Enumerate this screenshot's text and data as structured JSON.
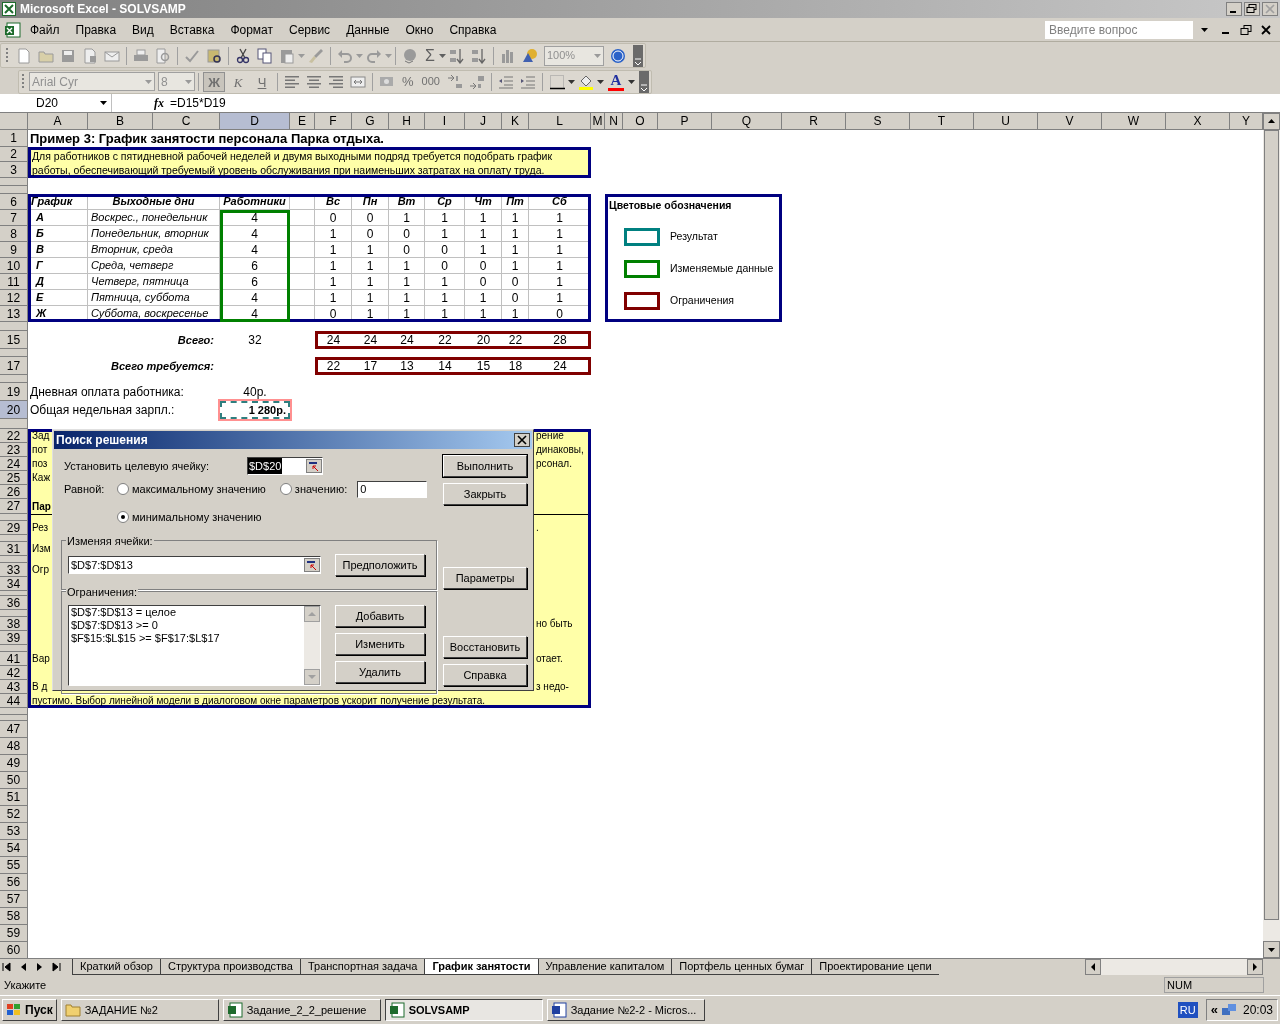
{
  "window": {
    "title": "Microsoft Excel - SOLVSAMP"
  },
  "menu": [
    "Файл",
    "Правка",
    "Вид",
    "Вставка",
    "Формат",
    "Сервис",
    "Данные",
    "Окно",
    "Справка"
  ],
  "help_search": {
    "placeholder": "Введите вопрос"
  },
  "toolbar": {
    "sum": "Σ",
    "zoom": "100%",
    "font": "Arial Cyr",
    "size": "8",
    "styles": [
      {
        "label": "Ж",
        "selected": true
      },
      {
        "label": "К",
        "selected": false
      },
      {
        "label": "Ч",
        "selected": false
      }
    ],
    "percent": "%",
    "thousands": "000",
    "font_color": "A"
  },
  "formula_bar": {
    "name_box": "D20",
    "fx": "fx",
    "formula": "=D15*D19"
  },
  "columns": [
    {
      "label": "A",
      "selected": false
    },
    {
      "label": "B",
      "selected": false
    },
    {
      "label": "C",
      "selected": false
    },
    {
      "label": "D",
      "selected": true
    },
    {
      "label": "E",
      "selected": false
    },
    {
      "label": "F",
      "selected": false
    },
    {
      "label": "G",
      "selected": false
    },
    {
      "label": "H",
      "selected": false
    },
    {
      "label": "I",
      "selected": false
    },
    {
      "label": "J",
      "selected": false
    },
    {
      "label": "K",
      "selected": false
    },
    {
      "label": "L",
      "selected": false
    },
    {
      "label": "M",
      "selected": false
    },
    {
      "label": "N",
      "selected": false
    },
    {
      "label": "O",
      "selected": false
    },
    {
      "label": "P",
      "selected": false
    },
    {
      "label": "Q",
      "selected": false
    },
    {
      "label": "R",
      "selected": false
    },
    {
      "label": "S",
      "selected": false
    },
    {
      "label": "T",
      "selected": false
    },
    {
      "label": "U",
      "selected": false
    },
    {
      "label": "V",
      "selected": false
    },
    {
      "label": "W",
      "selected": false
    },
    {
      "label": "X",
      "selected": false
    },
    {
      "label": "Y",
      "selected": false
    }
  ],
  "rows": [
    {
      "label": "1",
      "selected": false
    },
    {
      "label": "2",
      "selected": false
    },
    {
      "label": "3",
      "selected": false
    },
    {
      "label": "6",
      "selected": false
    },
    {
      "label": "7",
      "selected": false
    },
    {
      "label": "8",
      "selected": false
    },
    {
      "label": "9",
      "selected": false
    },
    {
      "label": "10",
      "selected": false
    },
    {
      "label": "11",
      "selected": false
    },
    {
      "label": "12",
      "selected": false
    },
    {
      "label": "13",
      "selected": false
    },
    {
      "label": "15",
      "selected": false
    },
    {
      "label": "17",
      "selected": false
    },
    {
      "label": "19",
      "selected": false
    },
    {
      "label": "20",
      "selected": true
    },
    {
      "label": "22",
      "selected": false
    },
    {
      "label": "23",
      "selected": false
    },
    {
      "label": "24",
      "selected": false
    },
    {
      "label": "25",
      "selected": false
    },
    {
      "label": "26",
      "selected": false
    },
    {
      "label": "27",
      "selected": false
    },
    {
      "label": "29",
      "selected": false
    },
    {
      "label": "31",
      "selected": false
    },
    {
      "label": "33",
      "selected": false
    },
    {
      "label": "34",
      "selected": false
    },
    {
      "label": "36",
      "selected": false
    },
    {
      "label": "38",
      "selected": false
    },
    {
      "label": "39",
      "selected": false
    },
    {
      "label": "41",
      "selected": false
    },
    {
      "label": "42",
      "selected": false
    },
    {
      "label": "43",
      "selected": false
    },
    {
      "label": "44",
      "selected": false
    },
    {
      "label": "47",
      "selected": false
    },
    {
      "label": "48",
      "selected": false
    },
    {
      "label": "49",
      "selected": false
    },
    {
      "label": "50",
      "selected": false
    },
    {
      "label": "51",
      "selected": false
    },
    {
      "label": "52",
      "selected": false
    },
    {
      "label": "53",
      "selected": false
    },
    {
      "label": "54",
      "selected": false
    },
    {
      "label": "55",
      "selected": false
    },
    {
      "label": "56",
      "selected": false
    },
    {
      "label": "57",
      "selected": false
    },
    {
      "label": "58",
      "selected": false
    },
    {
      "label": "59",
      "selected": false
    },
    {
      "label": "60",
      "selected": false
    }
  ],
  "sheet": {
    "title": "Пример 3:  График занятости персонала Парка отдыха.",
    "description": [
      "Для работников с пятидневной рабочей неделей и двумя выходными подряд требуется подобрать график",
      "работы, обеспечивающий требуемый уровень обслуживания при наименьших затратах на оплату труда."
    ],
    "schedule": {
      "headers": [
        "График",
        "Выходные дни",
        "Работники"
      ],
      "days": [
        "Вс",
        "Пн",
        "Вт",
        "Ср",
        "Чт",
        "Пт",
        "Сб"
      ],
      "rows": [
        {
          "schedule": "А",
          "days_off": "Воскрес., понедельник",
          "workers": "4",
          "values": [
            "0",
            "0",
            "1",
            "1",
            "1",
            "1",
            "1"
          ]
        },
        {
          "schedule": "Б",
          "days_off": "Понедельник, вторник",
          "workers": "4",
          "values": [
            "1",
            "0",
            "0",
            "1",
            "1",
            "1",
            "1"
          ]
        },
        {
          "schedule": "В",
          "days_off": "Вторник, среда",
          "workers": "4",
          "values": [
            "1",
            "1",
            "0",
            "0",
            "1",
            "1",
            "1"
          ]
        },
        {
          "schedule": "Г",
          "days_off": "Среда, четверг",
          "workers": "6",
          "values": [
            "1",
            "1",
            "1",
            "0",
            "0",
            "1",
            "1"
          ]
        },
        {
          "schedule": "Д",
          "days_off": "Четверг, пятница",
          "workers": "6",
          "values": [
            "1",
            "1",
            "1",
            "1",
            "0",
            "0",
            "1"
          ]
        },
        {
          "schedule": "Е",
          "days_off": "Пятница, суббота",
          "workers": "4",
          "values": [
            "1",
            "1",
            "1",
            "1",
            "1",
            "0",
            "1"
          ]
        },
        {
          "schedule": "Ж",
          "days_off": "Суббота, воскресенье",
          "workers": "4",
          "values": [
            "0",
            "1",
            "1",
            "1",
            "1",
            "1",
            "0"
          ]
        }
      ]
    },
    "totals": {
      "label": "Всего:",
      "workers": "32",
      "values": [
        "24",
        "24",
        "24",
        "22",
        "20",
        "22",
        "28"
      ]
    },
    "required": {
      "label": "Всего требуется:",
      "values": [
        "22",
        "17",
        "13",
        "14",
        "15",
        "18",
        "24"
      ]
    },
    "daily_pay": {
      "label": "Дневная оплата работника:",
      "value": "40р."
    },
    "weekly_pay": {
      "label": "Общая недельная зарпл.:",
      "value": "1 280р."
    },
    "notes": [
      {
        "left": "Зад",
        "right": "рение",
        "bold": false
      },
      {
        "left": "пот",
        "right": "динаковы,",
        "bold": false
      },
      {
        "left": "поз",
        "right": "рсонал.",
        "bold": false
      },
      {
        "left": "Каж",
        "bold": false
      },
      {
        "left": "Пар",
        "bold": true
      },
      {
        "left": "Рез",
        "right": ".",
        "bold": false
      },
      {
        "left": "Изм",
        "bold": false
      },
      {
        "left": "Огр",
        "bold": false
      },
      {
        "right": "но быть",
        "bold": false
      },
      {
        "left": "Вар",
        "right": "отает.",
        "bold": false
      },
      {
        "left": "В д",
        "right": "з недо-",
        "bold": false
      },
      {
        "left": "пустимо. Выбор линейной модели в диалоговом окне параметров ускорит получение результата.",
        "bold": false
      }
    ],
    "legend": {
      "title": "Цветовые обозначения",
      "items": [
        {
          "label": "Результат",
          "color": "#008080"
        },
        {
          "label": "Изменяемые данные",
          "color": "#008000"
        },
        {
          "label": "Ограничения",
          "color": "#800000"
        }
      ]
    }
  },
  "dialog": {
    "title": "Поиск решения",
    "target_label": "Установить целевую ячейку:",
    "target": "$D$20",
    "target_selected": true,
    "equal_label": "Равной:",
    "options": [
      {
        "label": "максимальному значению",
        "selected": false
      },
      {
        "label": "значению:",
        "selected": false
      },
      {
        "label": "минимальному значению",
        "selected": true
      }
    ],
    "value": "0",
    "changing_label": "Изменяя ячейки:",
    "changing": "$D$7:$D$13",
    "guess": "Предположить",
    "constraints_label": "Ограничения:",
    "constraints": [
      "$D$7:$D$13 = целое",
      "$D$7:$D$13 >= 0",
      "$F$15:$L$15 >= $F$17:$L$17"
    ],
    "constraint_buttons": [
      "Добавить",
      "Изменить",
      "Удалить"
    ],
    "buttons": [
      {
        "label": "Выполнить",
        "default": true
      },
      {
        "label": "Закрыть",
        "default": false
      },
      {
        "label": "Параметры",
        "default": false
      },
      {
        "label": "Восстановить",
        "default": false
      },
      {
        "label": "Справка",
        "default": false
      }
    ]
  },
  "sheet_tabs": [
    {
      "label": "Краткий обзор",
      "selected": false
    },
    {
      "label": "Структура производства",
      "selected": false
    },
    {
      "label": "Транспортная задача",
      "selected": false
    },
    {
      "label": "График занятости",
      "selected": true
    },
    {
      "label": "Управление капиталом",
      "selected": false
    },
    {
      "label": "Портфель ценных бумаг",
      "selected": false
    },
    {
      "label": "Проектирование цепи",
      "selected": false
    }
  ],
  "status_bar": {
    "message": "Укажите",
    "indicator": "NUM"
  },
  "taskbar": {
    "start": "Пуск",
    "items": [
      {
        "label": "ЗАДАНИЕ №2",
        "kind": "folder",
        "selected": false
      },
      {
        "label": "Задание_2_2_решение",
        "kind": "excel",
        "selected": false
      },
      {
        "label": "SOLVSAMP",
        "kind": "excel",
        "selected": true
      },
      {
        "label": "Задание №2-2 - Micros...",
        "kind": "word",
        "selected": false
      }
    ],
    "language": "RU",
    "tray_arrow": "«",
    "time": "20:03"
  }
}
